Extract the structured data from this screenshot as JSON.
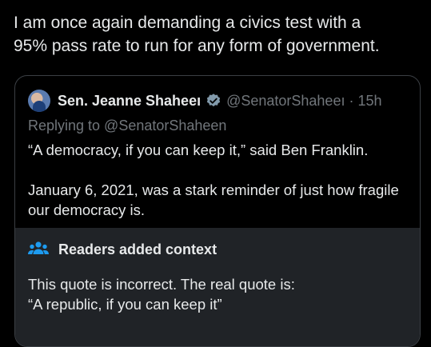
{
  "post": {
    "text": "I am once again demanding a civics test with a\n95% pass rate to run for any form of government."
  },
  "quote": {
    "author_name": "Sen. Jeanne Shaheeı",
    "verified_icon": "verified-badge-icon",
    "handle": "@SenatorShaheeı",
    "dot": "·",
    "time": "15h",
    "replying_to": "Replying to @SenatorShaheen",
    "body_line1": "“A democracy, if you can keep it,” said Ben Franklin.",
    "body_line2": "January 6, 2021, was a stark reminder of just how fragile our democracy is."
  },
  "context": {
    "icon": "people-icon",
    "title": "Readers added context",
    "line1": "This quote is incorrect. The real quote is:",
    "line2": "“A republic, if you can keep it”"
  },
  "colors": {
    "background": "#000000",
    "text": "#e7e9ea",
    "muted": "#71767b",
    "context_bg": "#202327",
    "accent": "#1d9bf0"
  }
}
